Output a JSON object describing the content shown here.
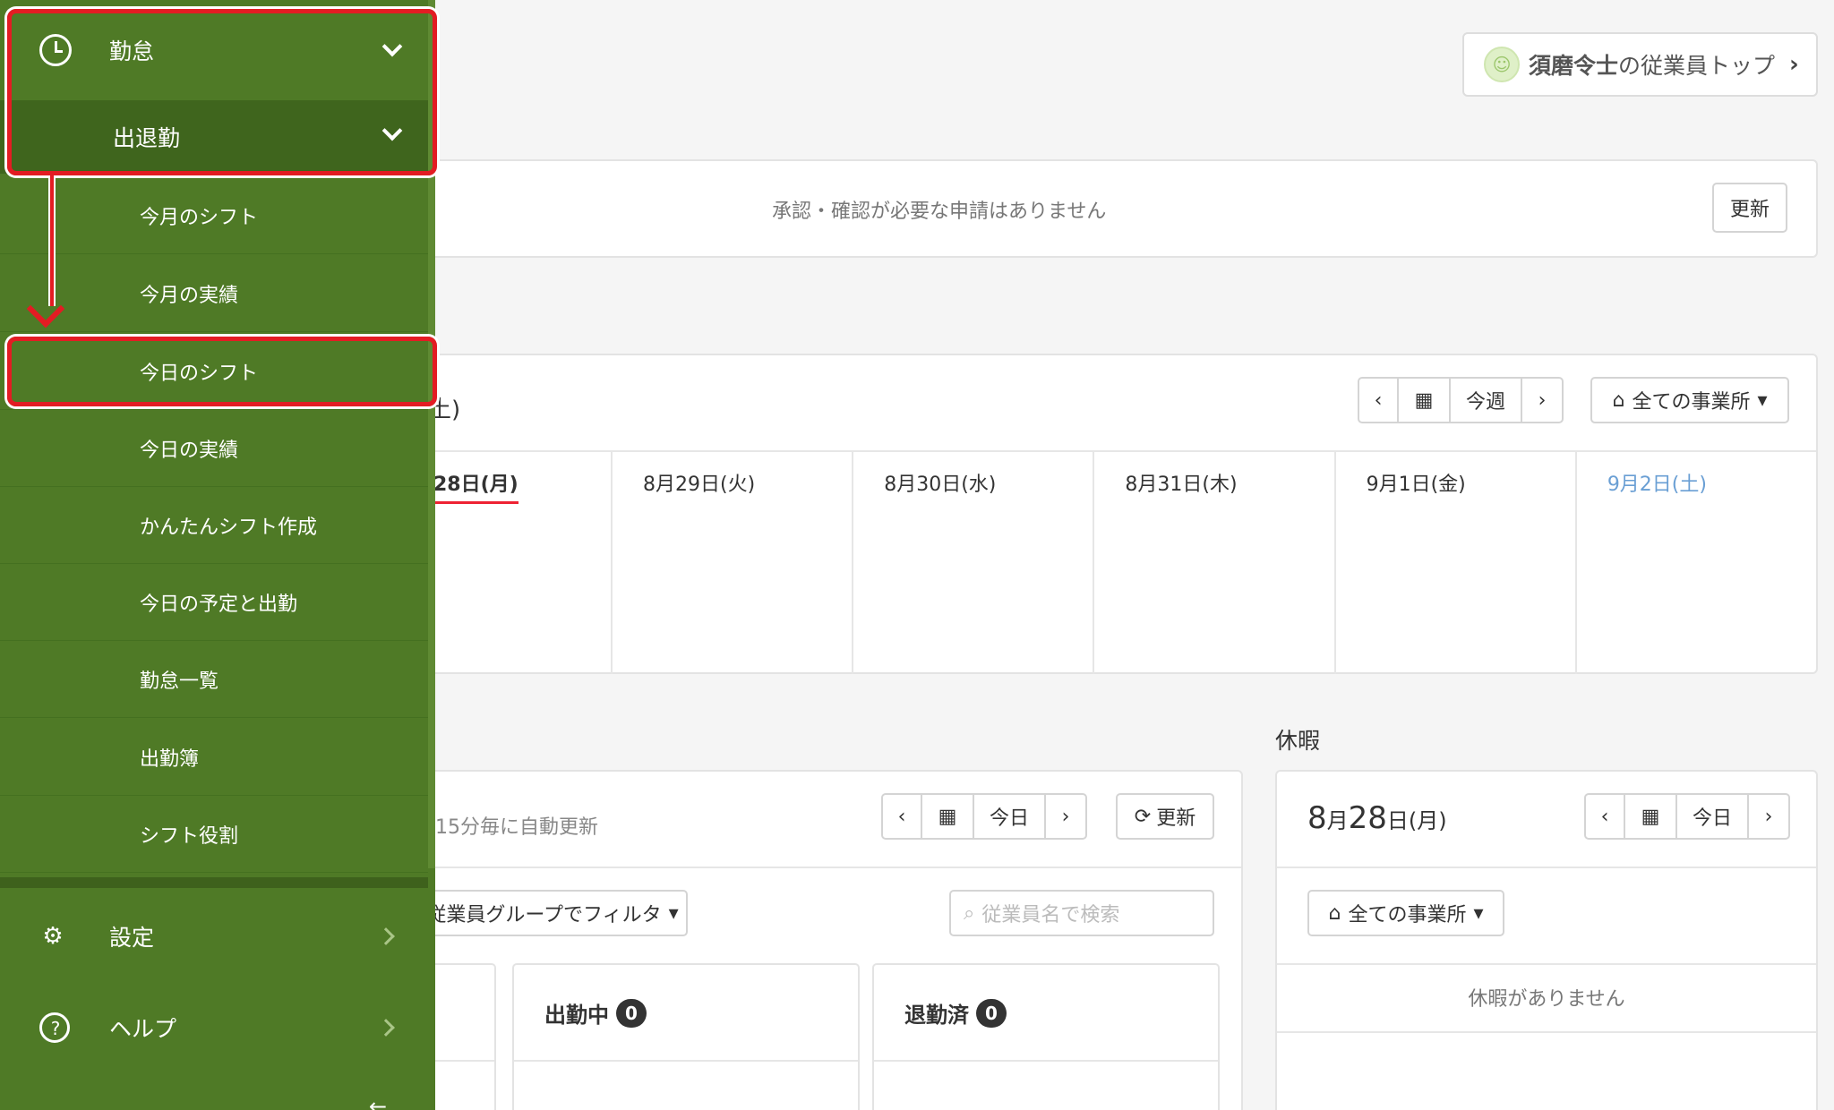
{
  "header": {
    "employee_name": "須磨令士",
    "top_suffix": "の従業員トップ"
  },
  "notice": {
    "message": "承認・確認が必要な申請はありません",
    "refresh_label": "更新"
  },
  "week": {
    "title_fragment": "土)",
    "this_week_label": "今週",
    "office_label": "全ての事業所",
    "days": [
      {
        "label": "28日(月)",
        "today": true
      },
      {
        "label": "8月29日(火)"
      },
      {
        "label": "8月30日(水)"
      },
      {
        "label": "8月31日(木)"
      },
      {
        "label": "9月1日(金)"
      },
      {
        "label": "9月2日(土)",
        "saturday": true
      }
    ]
  },
  "attendance": {
    "auto_update": "15分毎に自動更新",
    "today_label": "今日",
    "refresh_label": "更新",
    "filter_label": "従業員グループでフィルタ",
    "search_placeholder": "従業員名で検索",
    "columns": [
      {
        "title": "出勤中",
        "count": "0"
      },
      {
        "title": "退勤済",
        "count": "0"
      }
    ]
  },
  "leave": {
    "section_label": "休暇",
    "date_month": "8",
    "date_month_unit": "月",
    "date_day": "28",
    "date_day_unit": "日(月)",
    "today_label": "今日",
    "office_label": "全ての事業所",
    "empty_message": "休暇がありません"
  },
  "sidebar": {
    "attendance": "勤怠",
    "clock_in_out": "出退勤",
    "items": [
      "今月のシフト",
      "今月の実績",
      "今日のシフト",
      "今日の実績",
      "かんたんシフト作成",
      "今日の予定と出勤",
      "勤怠一覧",
      "出勤簿",
      "シフト役割"
    ],
    "settings": "設定",
    "help": "ヘルプ"
  },
  "colors": {
    "sidebar_bg": "#4f7a26",
    "sidebar_sub_bg": "#3f651d",
    "highlight_red": "#e31c23",
    "saturday_blue": "#6a9fd4"
  }
}
